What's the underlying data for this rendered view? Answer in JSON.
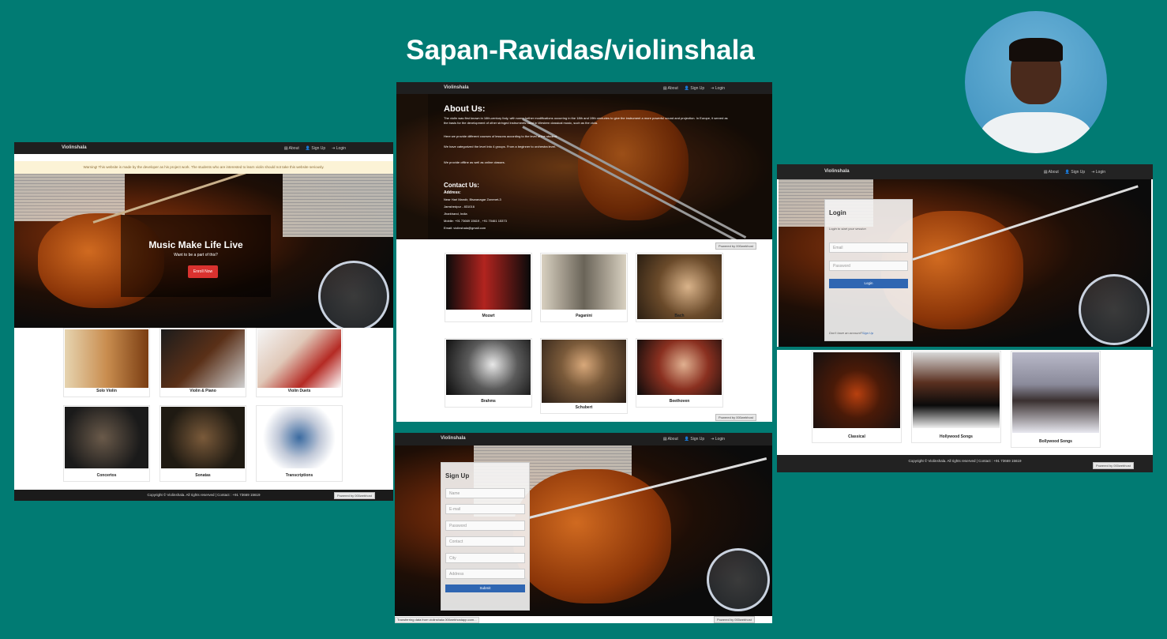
{
  "repo_title": "Sapan-Ravidas/violinshala",
  "nav": {
    "brand": "Violinshala",
    "about": "About",
    "signup": "Sign Up",
    "login": "Login"
  },
  "home": {
    "warning": "Warning! This website is made by the developer as his project work. The students who are interested to learn violin should not take this website seriously.",
    "hero_title": "Music Make Life Live",
    "hero_subtitle": "Want to be a part of this?",
    "enroll": "Enroll Now",
    "cards": [
      "Solo Violin",
      "Violin & Piano",
      "Violin Duets",
      "Concertos",
      "Sonatas",
      "Transcriptions"
    ],
    "footer": "Copyright © Violinshala. All rights reserved | Contact : +91 73669 15619"
  },
  "about": {
    "heading": "About Us:",
    "p1": "The violin was first known in 16th-century Italy, with some further modifications occurring in the 18th and 19th centuries to give the instrument a more powerful sound and projection. In Europe, it served as the basis for the development of other stringed instruments used in Western classical music, such as the viola.",
    "p2": "Here we provide different courses of lessons according to the level of the student.",
    "p3": "We have categorized the level into 4 groups. From a beginner to orchestra level.",
    "p4": "We provide offline as well as online classes.",
    "contact_heading": "Contact Us:",
    "address_label": "Address:",
    "addr1": "Near Hari Mandir, Biswanagar Zonenet-3",
    "addr2": "Jamshedpur - 831016",
    "addr3": "Jharkhand, India",
    "mobile": "Mobile: +91 73669 15619 , +91 70461 15373",
    "email": "Email: violinshala@gmail.com",
    "composers": [
      "Mozart",
      "Paganini",
      "Bach",
      "Brahms",
      "Schubert",
      "Beethoven"
    ],
    "powered": "Powered by 000webhost"
  },
  "login": {
    "heading": "Login",
    "subtitle": "Login to start your session",
    "email_ph": "Email",
    "password_ph": "Password",
    "button": "Login",
    "no_account": "Don't have an account?",
    "signup_link": "Sign Up",
    "cards": [
      "Classical",
      "Hollywood Songs",
      "Bollywood Songs"
    ],
    "footer": "Copyright © Violinshala. All rights reserved | Contact : +91 73669 15619"
  },
  "signup": {
    "heading": "Sign Up",
    "fields": [
      "Name",
      "E-mail",
      "Password",
      "Contact",
      "City",
      "Address"
    ],
    "button": "Submit",
    "status": "Transferring data from violinshala.000webhostapp.com..."
  }
}
